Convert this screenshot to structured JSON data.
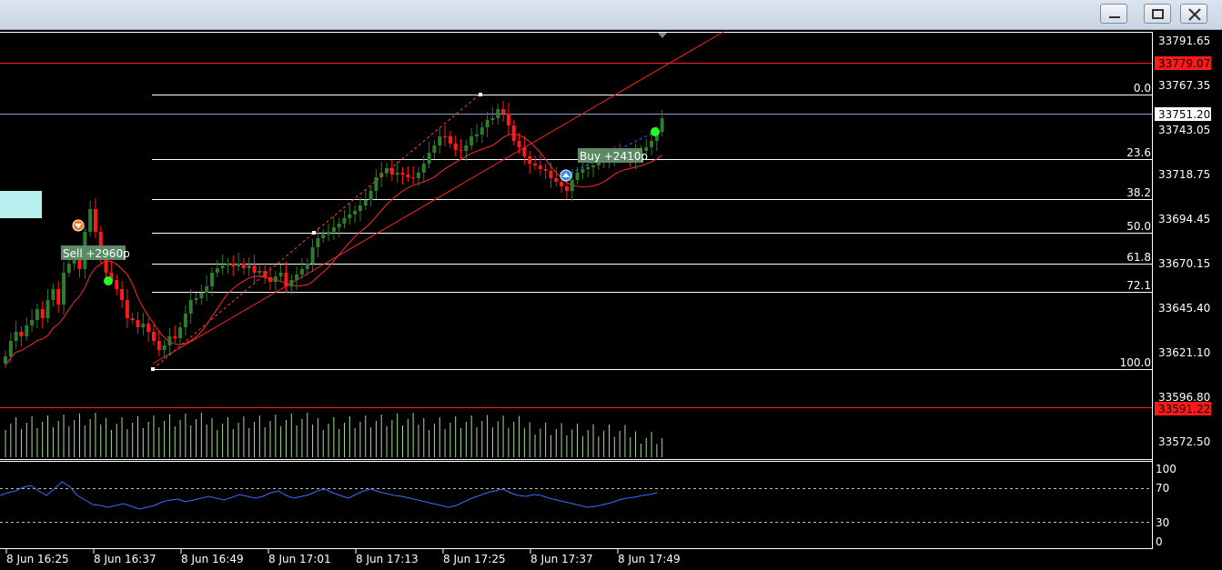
{
  "window": {
    "buttons": [
      "minimize-button",
      "maximize-button",
      "close-button"
    ]
  },
  "price_axis": {
    "labels": [
      "33791.65",
      "33767.35",
      "33743.05",
      "33718.75",
      "33694.45",
      "33670.15",
      "33645.40",
      "33621.10",
      "33596.80",
      "33572.50"
    ],
    "current_price": "33751.20",
    "upper_line_price": "33779.07",
    "lower_line_price": "33591.22"
  },
  "fibonacci": {
    "levels": [
      "0.0",
      "23.6",
      "38.2",
      "50.0",
      "61.8",
      "72.1",
      "100.0"
    ]
  },
  "trades": {
    "sell_label": "Sell +2960p",
    "buy_label": "Buy +2410p"
  },
  "rsi_axis": {
    "labels": [
      "100",
      "70",
      "30",
      "0"
    ]
  },
  "time_axis": {
    "labels": [
      "8 Jun 16:25",
      "8 Jun 16:37",
      "8 Jun 16:49",
      "8 Jun 17:01",
      "8 Jun 17:13",
      "8 Jun 17:25",
      "8 Jun 17:37",
      "8 Jun 17:49"
    ]
  },
  "colors": {
    "bull": "#2e7d2e",
    "bear": "#ff1a1a",
    "ma": "#ff2a2a",
    "rsi": "#3d6bff",
    "volume": "#a8d89a",
    "grid_line": "#ffffff"
  }
}
